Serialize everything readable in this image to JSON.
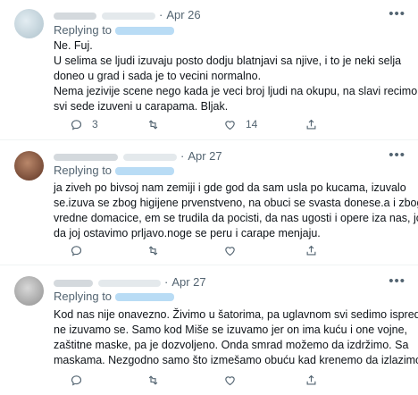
{
  "tweets": [
    {
      "date": "Apr 26",
      "replying_to": "Replying to",
      "lines": [
        "Ne. Fuj.",
        "U selima se ljudi izuvaju posto dodju blatnjavi sa njive, i to je neki selja",
        "doneo u grad i sada je to vecini normalno.",
        "Nema jezivije scene nego kada je veci broj ljudi na okupu, na slavi recimo, i",
        "svi sede izuveni u carapama. Bljak."
      ],
      "replies": "3",
      "retweets": "",
      "likes": "14"
    },
    {
      "date": "Apr 27",
      "replying_to": "Replying to",
      "lines": [
        "ja ziveh po bivsoj nam zemiji i gde god da sam usla po kucama, izuvalo",
        "se.izuva se zbog higijene prvenstveno, na obuci se svasta donese.a i zbog",
        "vredne domacice, em se trudila da pocisti, da nas ugosti i opere iza nas, jos",
        "da joj ostavimo prljavo.noge se peru i carape menjaju."
      ],
      "replies": "",
      "retweets": "",
      "likes": ""
    },
    {
      "date": "Apr 27",
      "replying_to": "Replying to",
      "lines": [
        "Kod nas nije onavezno. Živimo u šatorima, pa uglavnom svi sedimo ispred i",
        "ne izuvamo se. Samo kod Miše se izuvamo jer on ima kuću i one vojne,",
        "zaštitne maske, pa je dozvoljeno. Onda smrad možemo da izdržimo. Sa",
        "maskama. Nezgodno samo što izmešamo obuću kad krenemo da izlazimo."
      ],
      "replies": "",
      "retweets": "",
      "likes": ""
    }
  ],
  "icons": {
    "reply": "reply-icon",
    "retweet": "retweet-icon",
    "like": "heart-icon",
    "share": "share-icon",
    "more": "more-icon"
  },
  "colors": {
    "text": "#0f1419",
    "secondary": "#536471",
    "divider": "#eff3f4"
  }
}
